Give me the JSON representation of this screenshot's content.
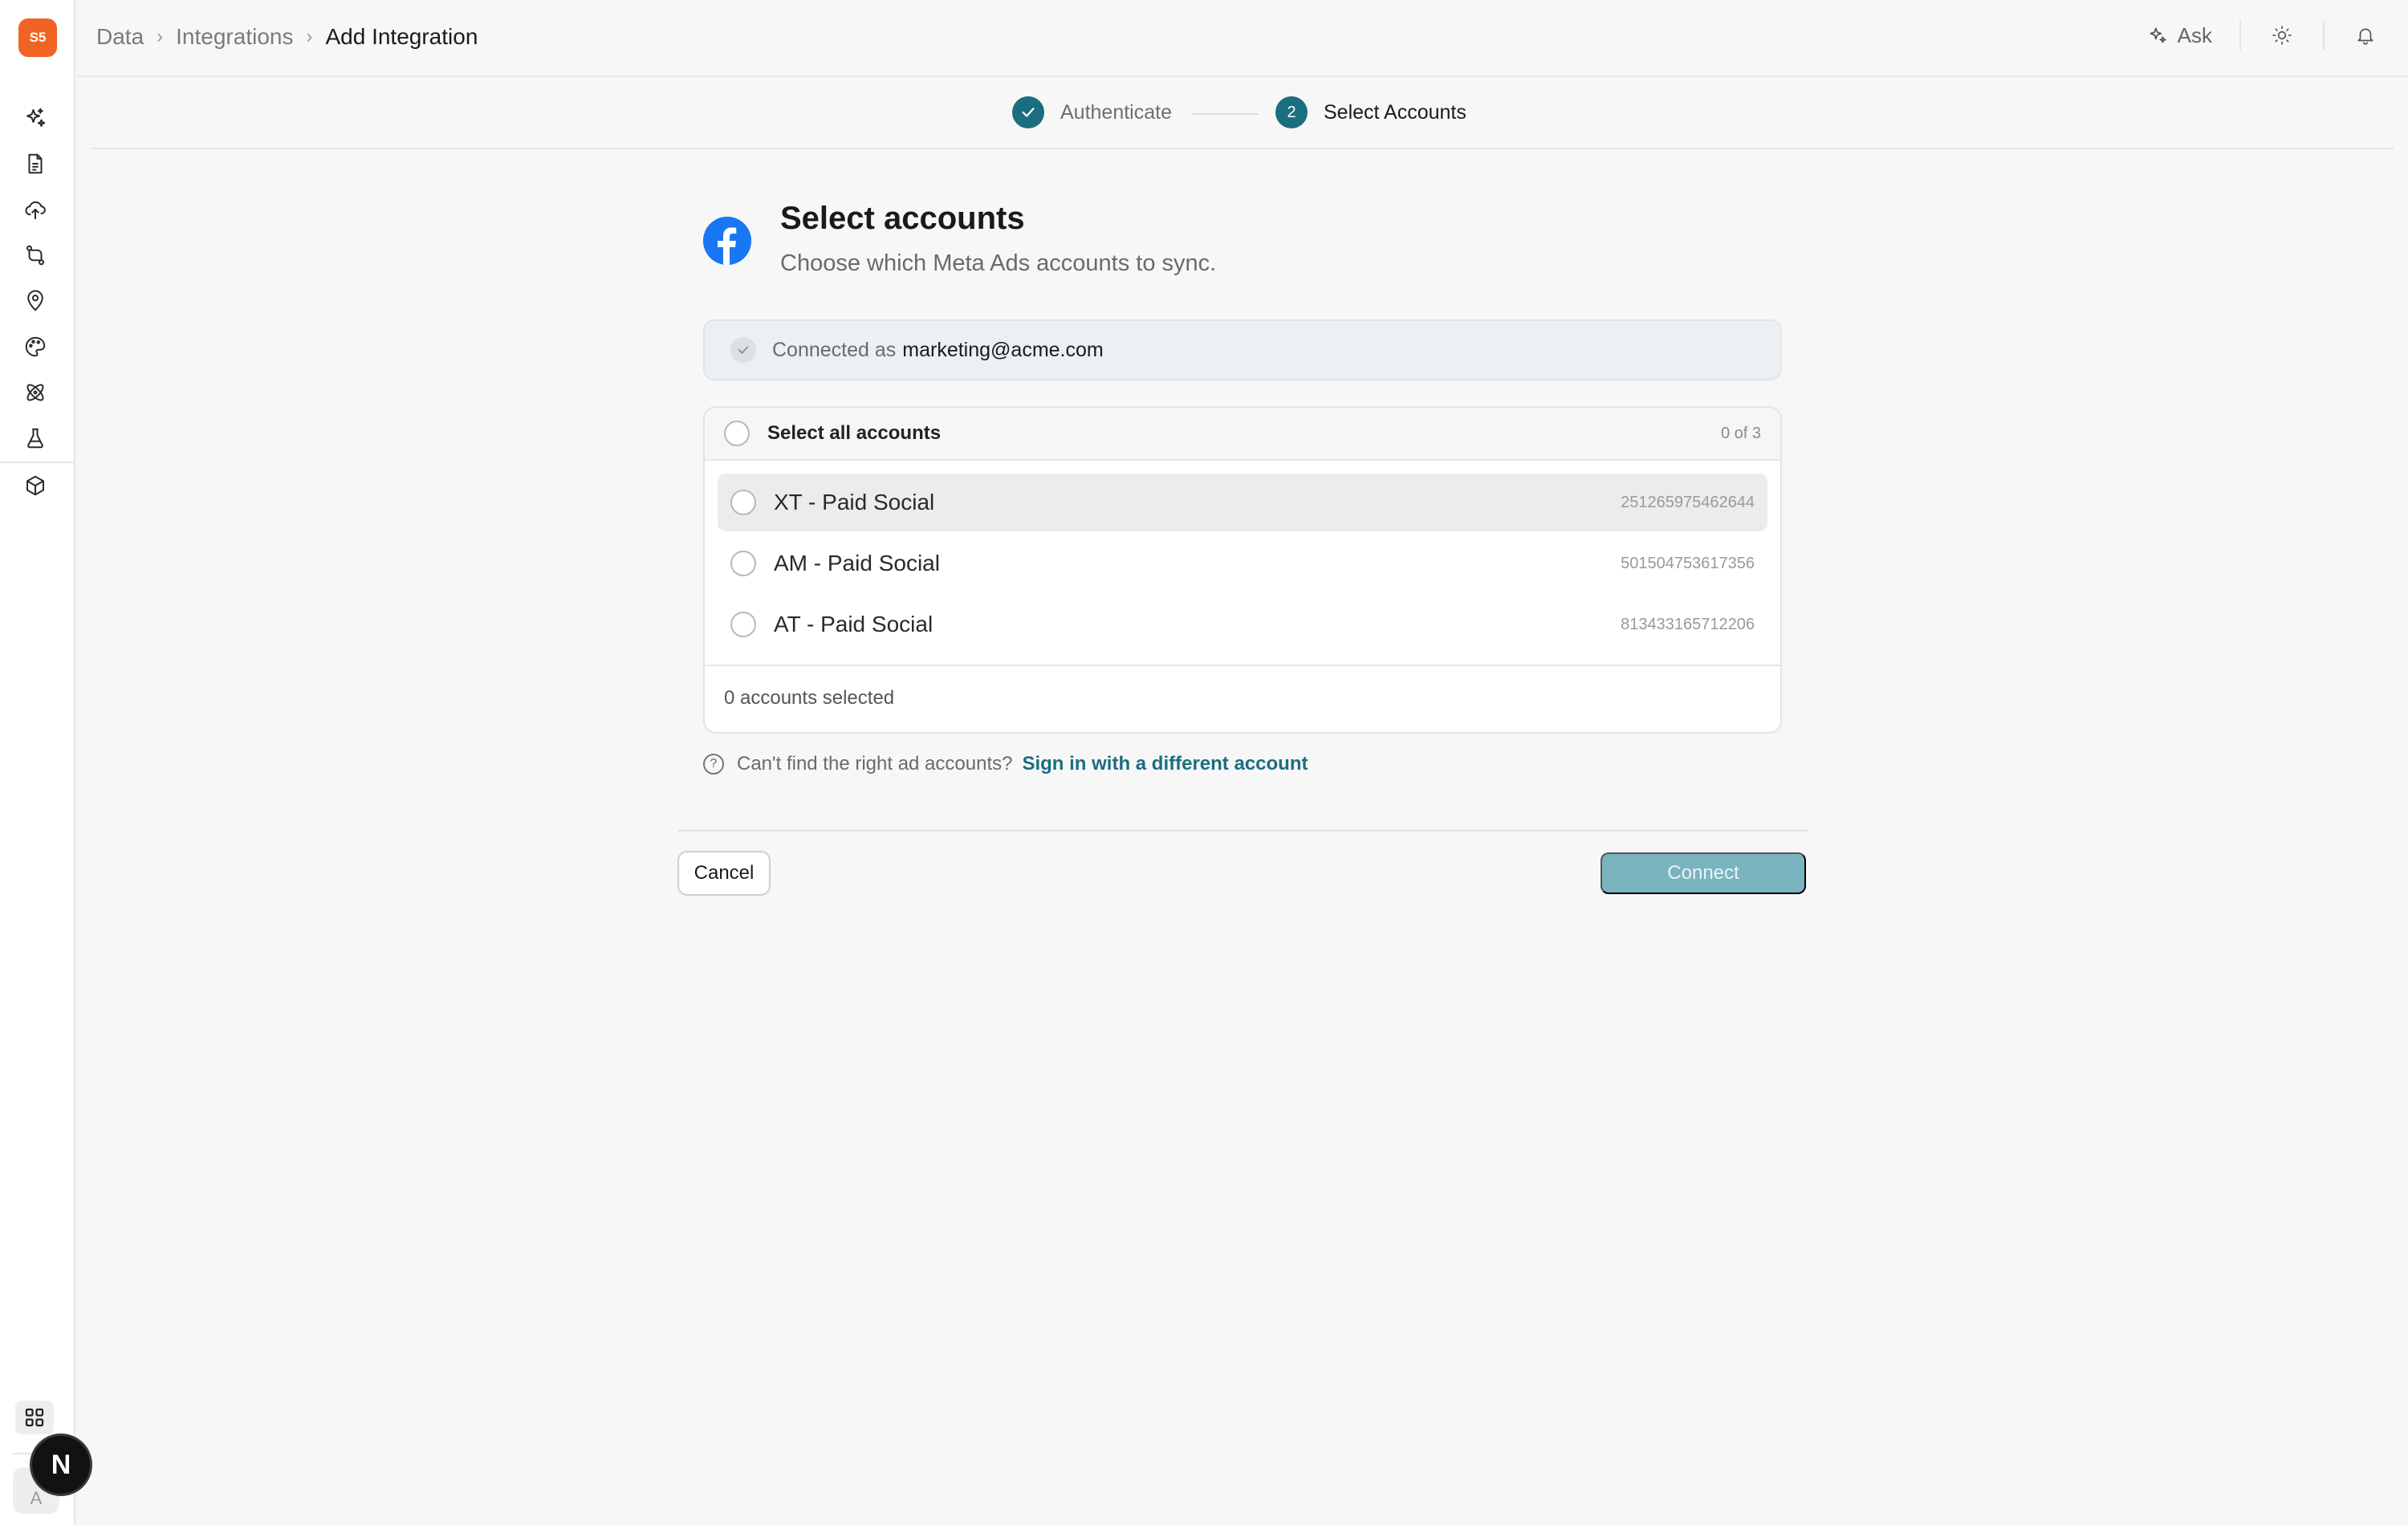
{
  "sidebar": {
    "logo_text": "S5",
    "icons": [
      "sparkles-icon",
      "document-icon",
      "cloud-upload-icon",
      "git-compare-icon",
      "map-pin-icon",
      "palette-icon",
      "atom-icon",
      "flask-icon",
      "cube-icon"
    ],
    "bottom": {
      "apps_icon": "grid-icon",
      "avatar_initial": "A",
      "badge_letter": "N"
    }
  },
  "breadcrumb": [
    "Data",
    "Integrations",
    "Add Integration"
  ],
  "topbar": {
    "ask_label": "Ask",
    "theme_icon": "sun-icon",
    "notifications_icon": "bell-icon"
  },
  "stepper": {
    "steps": [
      {
        "label": "Authenticate",
        "state": "complete"
      },
      {
        "number": "2",
        "label": "Select Accounts",
        "state": "current"
      }
    ]
  },
  "header": {
    "title": "Select accounts",
    "subtitle": "Choose which Meta Ads accounts to sync.",
    "brand_icon": "facebook-icon",
    "brand_color": "#1877f2"
  },
  "connection": {
    "prefix": "Connected as",
    "email": "marketing@acme.com"
  },
  "accounts": {
    "select_all_label": "Select all accounts",
    "count_label": "0 of 3",
    "rows": [
      {
        "name": "XT - Paid Social",
        "id": "251265975462644",
        "checked": false
      },
      {
        "name": "AM - Paid Social",
        "id": "501504753617356",
        "checked": false
      },
      {
        "name": "AT - Paid Social",
        "id": "813433165712206",
        "checked": false
      }
    ],
    "selected_summary": "0 accounts selected"
  },
  "help": {
    "text": "Can't find the right ad accounts?",
    "link": "Sign in with a different account"
  },
  "actions": {
    "cancel": "Cancel",
    "connect": "Connect"
  },
  "colors": {
    "accent": "#1a6e80",
    "logo": "#f06423",
    "connect_disabled": "#7ab4be"
  }
}
